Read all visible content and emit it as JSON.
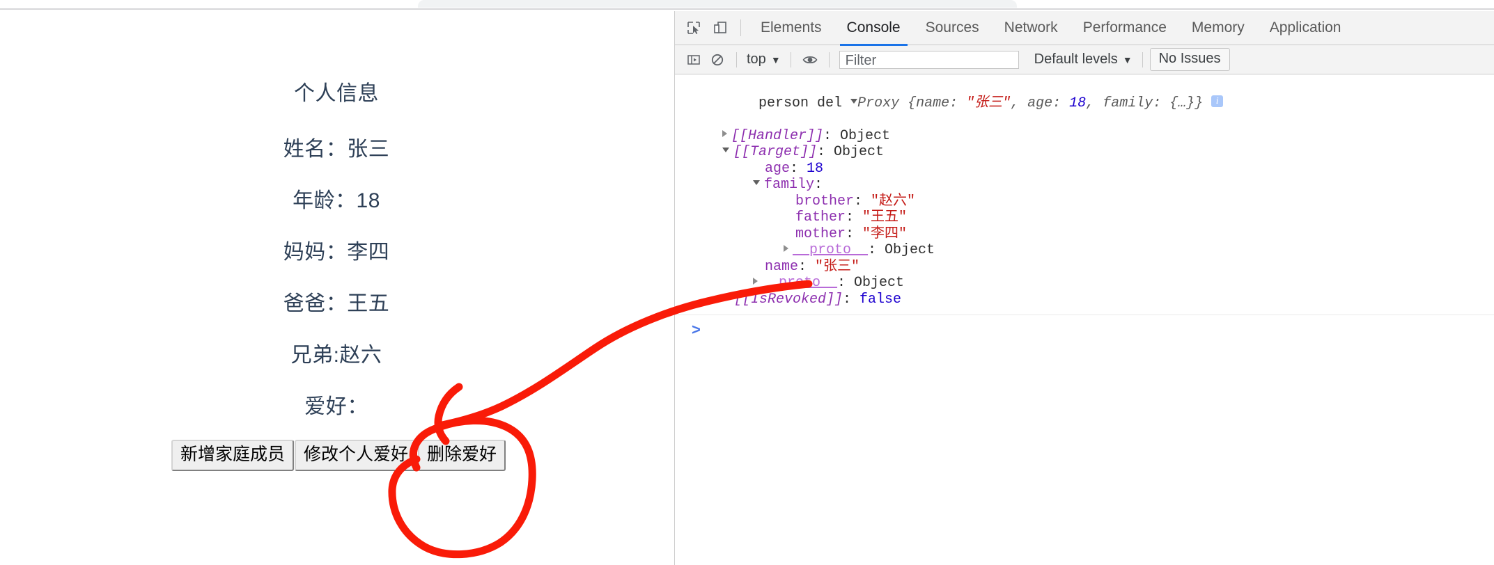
{
  "browser": {
    "chrome_strip": "browser-chrome-strip"
  },
  "page": {
    "title": "个人信息",
    "fields": [
      {
        "label": "姓名：张三"
      },
      {
        "label": "年龄：18"
      },
      {
        "label": "妈妈：李四"
      },
      {
        "label": "爸爸：王五"
      },
      {
        "label": "兄弟:赵六"
      },
      {
        "label": "爱好："
      }
    ],
    "buttons": [
      {
        "label": "新增家庭成员"
      },
      {
        "label": "修改个人爱好"
      },
      {
        "label": "删除爱好"
      }
    ],
    "text_color": "#2e4057"
  },
  "devtools": {
    "tabs": [
      {
        "label": "Elements",
        "active": false
      },
      {
        "label": "Console",
        "active": true
      },
      {
        "label": "Sources",
        "active": false
      },
      {
        "label": "Network",
        "active": false
      },
      {
        "label": "Performance",
        "active": false
      },
      {
        "label": "Memory",
        "active": false
      },
      {
        "label": "Application",
        "active": false
      }
    ],
    "active_tab": "Console",
    "accent_color": "#1a73e8",
    "icons": {
      "inspect": "inspect-element-icon",
      "device": "device-toolbar-icon",
      "sidebar": "console-sidebar-icon",
      "clear": "clear-console-icon",
      "eye": "live-expression-icon"
    },
    "toolbar": {
      "context_selector": "top",
      "filter_placeholder": "Filter",
      "filter_value": "",
      "levels_selector": "Default levels",
      "issues_label": "No Issues"
    },
    "console": {
      "log_label": "person del",
      "summary": {
        "ctor": "Proxy",
        "open": " {",
        "k_name": "name: ",
        "v_name": "\"张三\"",
        "sep1": ", ",
        "k_age": "age: ",
        "v_age": "18",
        "sep2": ", ",
        "k_family": "family: ",
        "v_family": "{…}",
        "close": "}",
        "badge": "i"
      },
      "rows": [
        {
          "indent": 1,
          "marker": "right",
          "key": "[[Handler]]",
          "key_style": "internal",
          "sep": ": ",
          "value": "Object",
          "value_style": "plain"
        },
        {
          "indent": 1,
          "marker": "down",
          "key": "[[Target]]",
          "key_style": "internal",
          "sep": ": ",
          "value": "Object",
          "value_style": "plain"
        },
        {
          "indent": 2,
          "marker": "none",
          "key": "age",
          "key_style": "key",
          "sep": ": ",
          "value": "18",
          "value_style": "num"
        },
        {
          "indent": 2,
          "marker": "down",
          "key": "family",
          "key_style": "key",
          "sep": ":",
          "value": "",
          "value_style": "plain"
        },
        {
          "indent": 3,
          "marker": "none",
          "key": "brother",
          "key_style": "key",
          "sep": ": ",
          "value": "\"赵六\"",
          "value_style": "str"
        },
        {
          "indent": 3,
          "marker": "none",
          "key": "father",
          "key_style": "key",
          "sep": ": ",
          "value": "\"王五\"",
          "value_style": "str"
        },
        {
          "indent": 3,
          "marker": "none",
          "key": "mother",
          "key_style": "key",
          "sep": ": ",
          "value": "\"李四\"",
          "value_style": "str"
        },
        {
          "indent": 3,
          "marker": "right",
          "key": "__proto__",
          "key_style": "proto",
          "sep": ": ",
          "value": "Object",
          "value_style": "plain"
        },
        {
          "indent": 2,
          "marker": "none",
          "key": "name",
          "key_style": "key",
          "sep": ": ",
          "value": "\"张三\"",
          "value_style": "str"
        },
        {
          "indent": 2,
          "marker": "right",
          "key": "__proto__",
          "key_style": "proto",
          "sep": ": ",
          "value": "Object",
          "value_style": "plain"
        },
        {
          "indent": 1,
          "marker": "none",
          "key": "[[IsRevoked]]",
          "key_style": "internal",
          "sep": ": ",
          "value": "false",
          "value_style": "num"
        }
      ],
      "prompt": ">"
    }
  },
  "annotation": {
    "color": "#f91b08",
    "circle_target": "删除爱好",
    "shapes": [
      "arrow-pointing-left",
      "circle-around-delete-button"
    ]
  }
}
